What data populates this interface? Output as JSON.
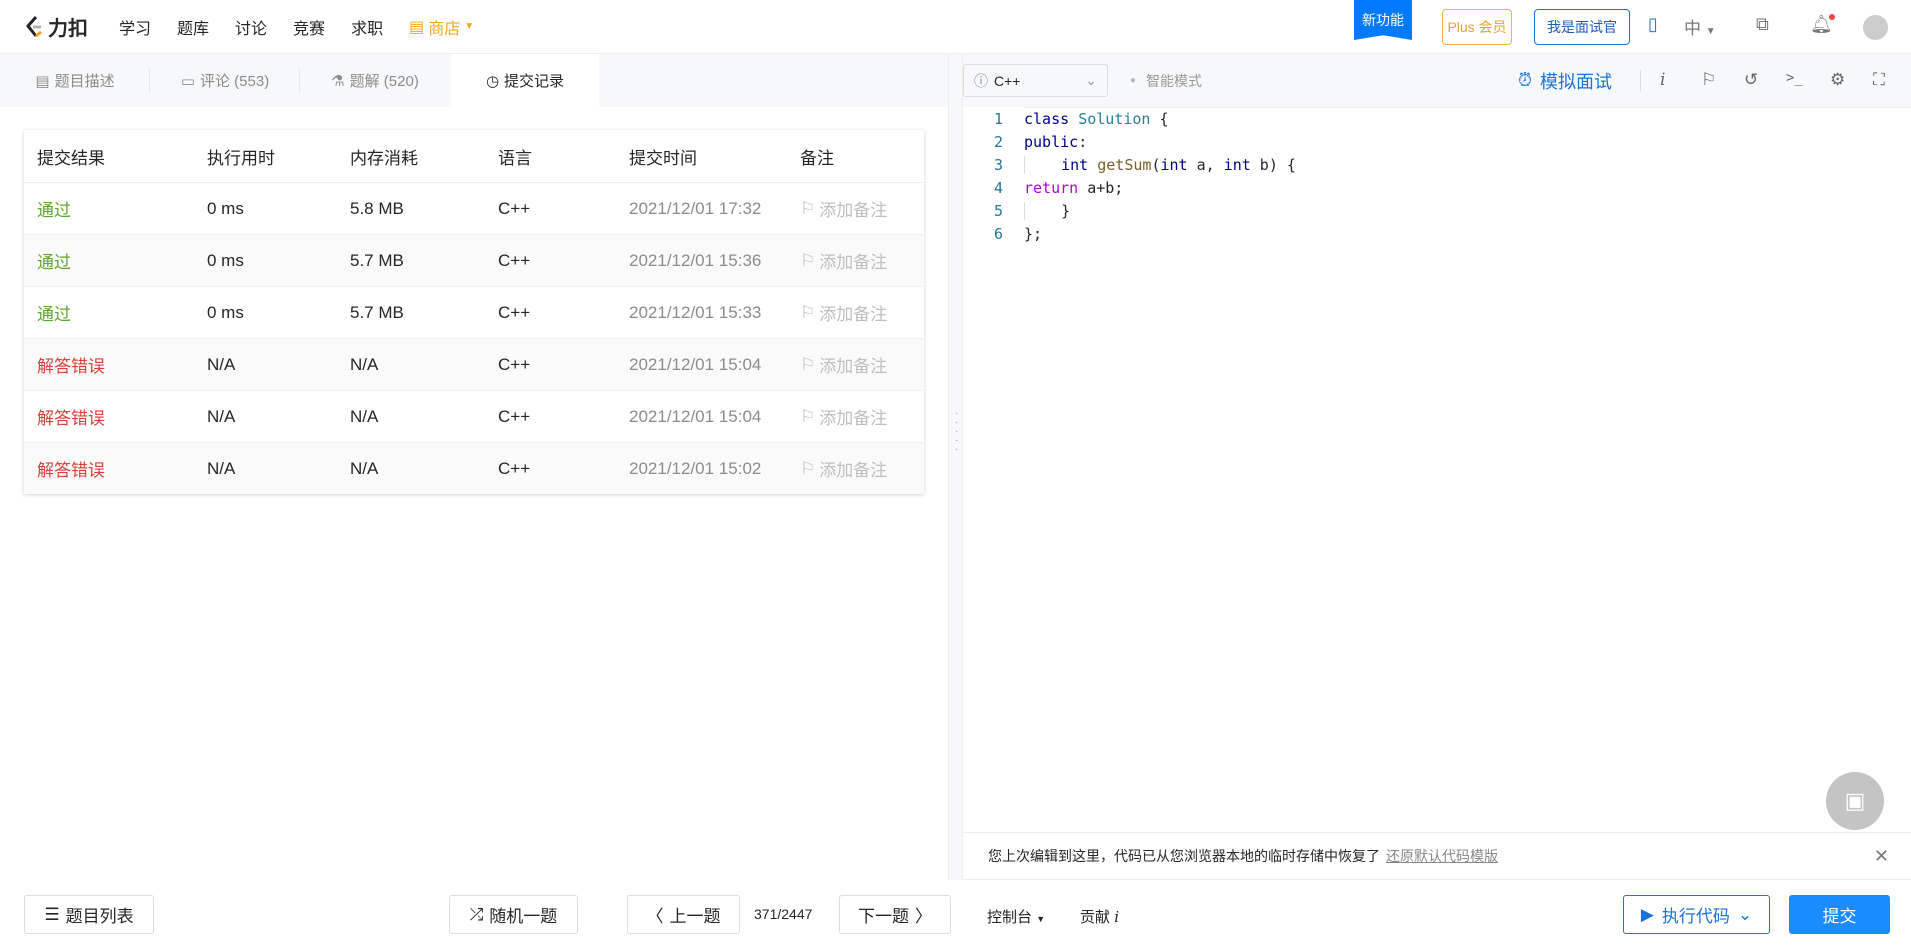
{
  "nav": {
    "logo": "力扣",
    "items": [
      "学习",
      "题库",
      "讨论",
      "竞赛",
      "求职"
    ],
    "shop": "商店",
    "new_feature": "新功能",
    "plus": "Plus 会员",
    "interviewer": "我是面试官",
    "lang": "中"
  },
  "tabs": [
    {
      "label": "题目描述"
    },
    {
      "label": "评论 (553)"
    },
    {
      "label": "题解 (520)"
    },
    {
      "label": "提交记录"
    }
  ],
  "table": {
    "headers": [
      "提交结果",
      "执行用时",
      "内存消耗",
      "语言",
      "提交时间",
      "备注"
    ],
    "rows": [
      {
        "status": "通过",
        "time": "0 ms",
        "memory": "5.8 MB",
        "lang": "C++",
        "submitted": "2021/12/01 17:32",
        "note": "添加备注"
      },
      {
        "status": "通过",
        "time": "0 ms",
        "memory": "5.7 MB",
        "lang": "C++",
        "submitted": "2021/12/01 15:36",
        "note": "添加备注"
      },
      {
        "status": "通过",
        "time": "0 ms",
        "memory": "5.7 MB",
        "lang": "C++",
        "submitted": "2021/12/01 15:33",
        "note": "添加备注"
      },
      {
        "status": "解答错误",
        "time": "N/A",
        "memory": "N/A",
        "lang": "C++",
        "submitted": "2021/12/01 15:04",
        "note": "添加备注"
      },
      {
        "status": "解答错误",
        "time": "N/A",
        "memory": "N/A",
        "lang": "C++",
        "submitted": "2021/12/01 15:04",
        "note": "添加备注"
      },
      {
        "status": "解答错误",
        "time": "N/A",
        "memory": "N/A",
        "lang": "C++",
        "submitted": "2021/12/01 15:02",
        "note": "添加备注"
      }
    ]
  },
  "editor": {
    "language": "C++",
    "smart_mode": "智能模式",
    "mock_interview": "模拟面试",
    "info": "i",
    "lines": [
      "1",
      "2",
      "3",
      "4",
      "5",
      "6"
    ]
  },
  "notice": {
    "text": "您上次编辑到这里，代码已从您浏览器本地的临时存储中恢复了",
    "link": "还原默认代码模版"
  },
  "bottom": {
    "problem_list": "题目列表",
    "random": "随机一题",
    "prev": "上一题",
    "page": "371/2447",
    "next": "下一题",
    "console": "控制台",
    "contribute": "贡献",
    "run": "执行代码",
    "submit": "提交"
  }
}
